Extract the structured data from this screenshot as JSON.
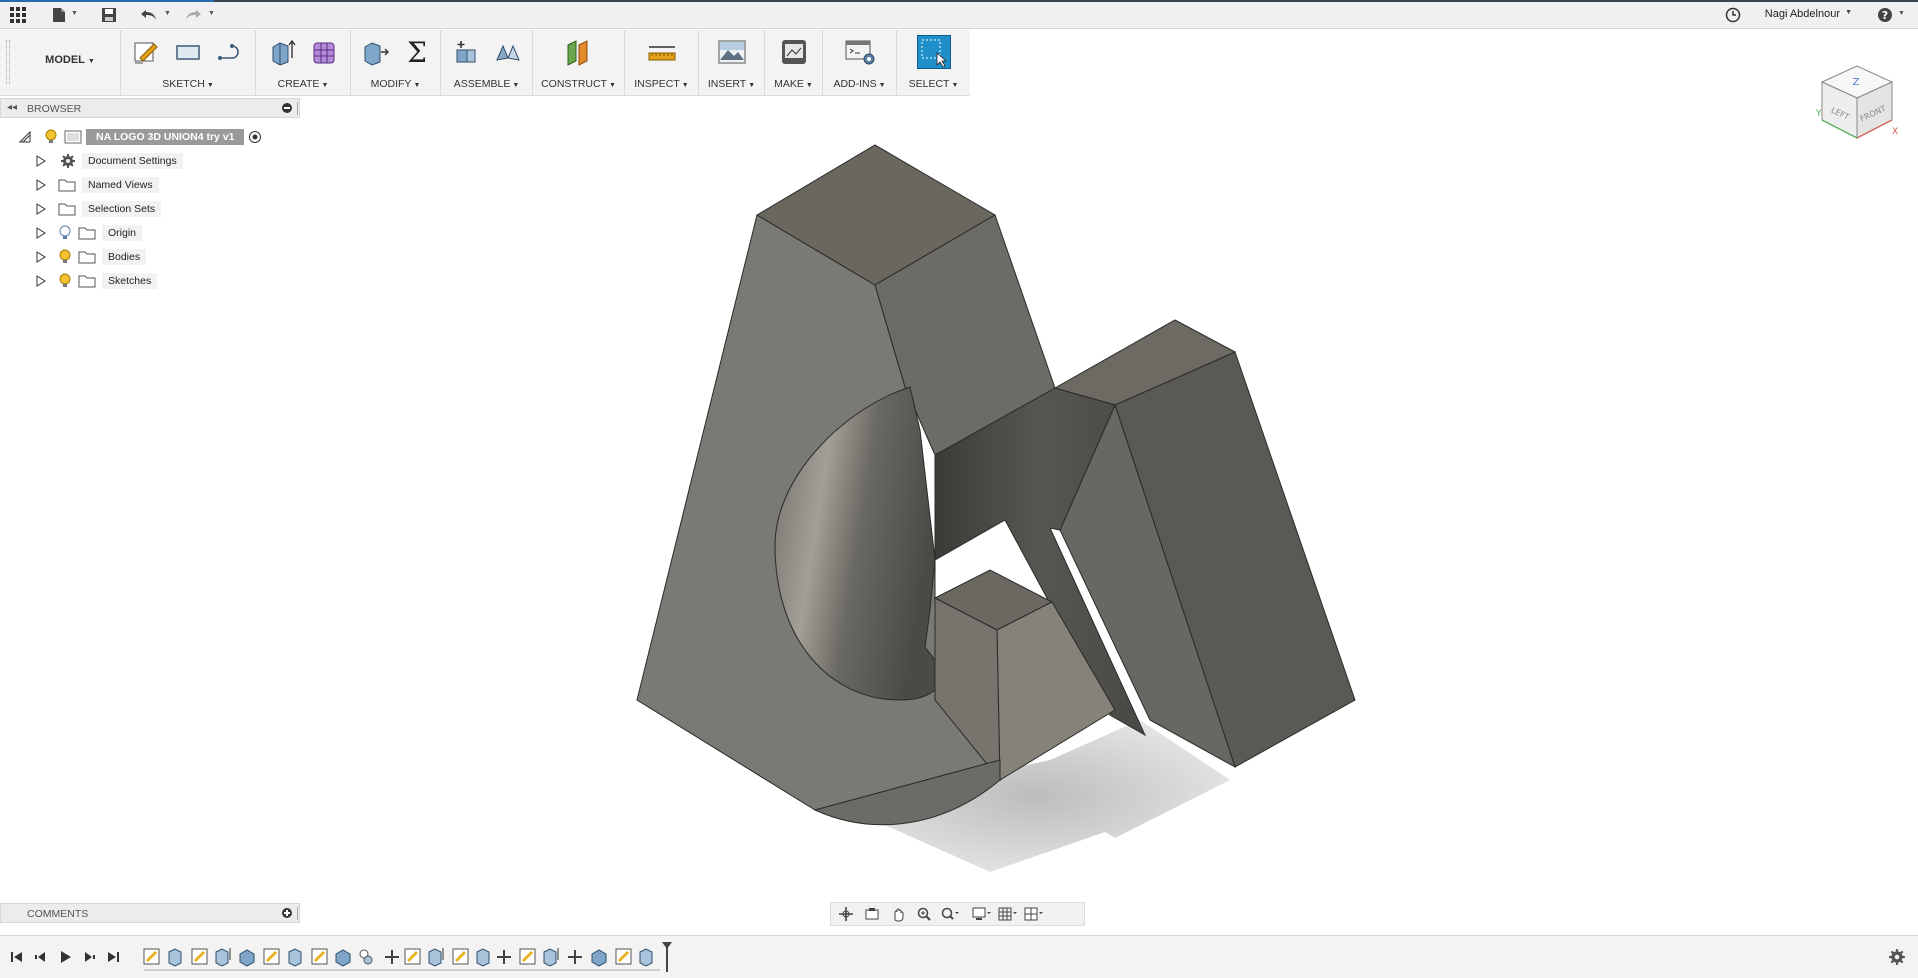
{
  "app": {
    "user_name": "Nagi Abdelnour",
    "workspace": "MODEL"
  },
  "icons": {
    "apps": "grid-icon",
    "file": "file-icon",
    "save": "save-icon",
    "undo": "undo-icon",
    "redo": "redo-icon",
    "job_status": "clock-icon",
    "help": "help-icon"
  },
  "toolbar": {
    "groups": [
      {
        "label": "SKETCH"
      },
      {
        "label": "CREATE"
      },
      {
        "label": "MODIFY"
      },
      {
        "label": "ASSEMBLE"
      },
      {
        "label": "CONSTRUCT"
      },
      {
        "label": "INSPECT"
      },
      {
        "label": "INSERT"
      },
      {
        "label": "MAKE"
      },
      {
        "label": "ADD-INS"
      },
      {
        "label": "SELECT"
      }
    ]
  },
  "browser": {
    "title": "BROWSER",
    "root": "NA LOGO 3D UNION4 try v1",
    "items": [
      {
        "label": "Document Settings"
      },
      {
        "label": "Named Views"
      },
      {
        "label": "Selection Sets"
      },
      {
        "label": "Origin"
      },
      {
        "label": "Bodies"
      },
      {
        "label": "Sketches"
      }
    ]
  },
  "comments": {
    "title": "COMMENTS"
  },
  "viewcube": {
    "top": "Z",
    "left": "LEFT",
    "front": "FRONT",
    "axis_y": "Y",
    "axis_x": "X"
  },
  "colors": {
    "select_accent": "#1f8fc9",
    "body_face_light": "#7a7872",
    "body_face_dark": "#55534e",
    "body_top": "#6b6860",
    "timeline_feature": "#e6b422"
  }
}
